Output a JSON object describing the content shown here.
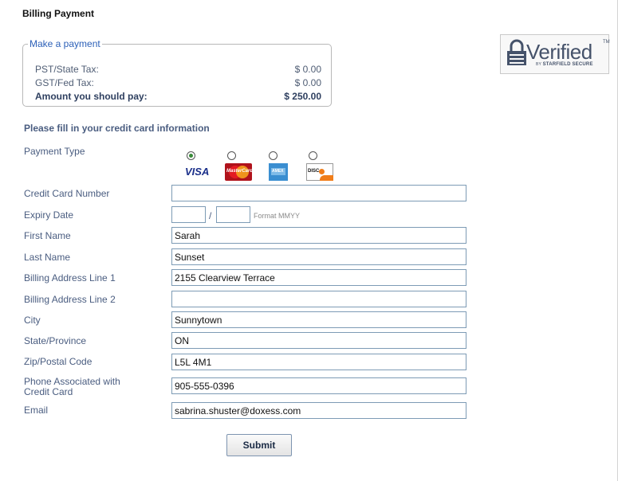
{
  "page": {
    "title": "Billing Payment"
  },
  "payment_box": {
    "legend": "Make a payment",
    "rows": [
      {
        "label": "PST/State Tax:",
        "amount": "$ 0.00"
      },
      {
        "label": "GST/Fed Tax:",
        "amount": "$ 0.00"
      },
      {
        "label": "Amount you should pay:",
        "amount": "$ 250.00"
      }
    ]
  },
  "badge": {
    "text": "Verified",
    "tm": "TM",
    "by": "BY",
    "sub": "STARFIELD SECURE"
  },
  "form": {
    "heading": "Please fill in your credit card information",
    "payment_type": {
      "label": "Payment Type",
      "options": [
        "VISA",
        "MasterCard",
        "American Express",
        "DISCOVER"
      ],
      "selected": "VISA"
    },
    "card_number": {
      "label": "Credit Card Number",
      "value": ""
    },
    "expiry": {
      "label": "Expiry Date",
      "month": "",
      "year": "",
      "separator": "/",
      "hint": "Format MMYY"
    },
    "first_name": {
      "label": "First Name",
      "value": "Sarah"
    },
    "last_name": {
      "label": "Last Name",
      "value": "Sunset"
    },
    "address1": {
      "label": "Billing Address Line 1",
      "value": "2155 Clearview Terrace"
    },
    "address2": {
      "label": "Billing Address Line 2",
      "value": ""
    },
    "city": {
      "label": "City",
      "value": "Sunnytown"
    },
    "state": {
      "label": "State/Province",
      "value": "ON"
    },
    "zip": {
      "label": "Zip/Postal Code",
      "value": "L5L 4M1"
    },
    "phone": {
      "label": "Phone Associated with Credit Card",
      "value": "905-555-0396"
    },
    "email": {
      "label": "Email",
      "value": "sabrina.shuster@doxess.com"
    },
    "submit_label": "Submit"
  },
  "colors": {
    "label": "#4a5d80",
    "legend": "#2d61b8",
    "input_border": "#7d9bb5"
  }
}
